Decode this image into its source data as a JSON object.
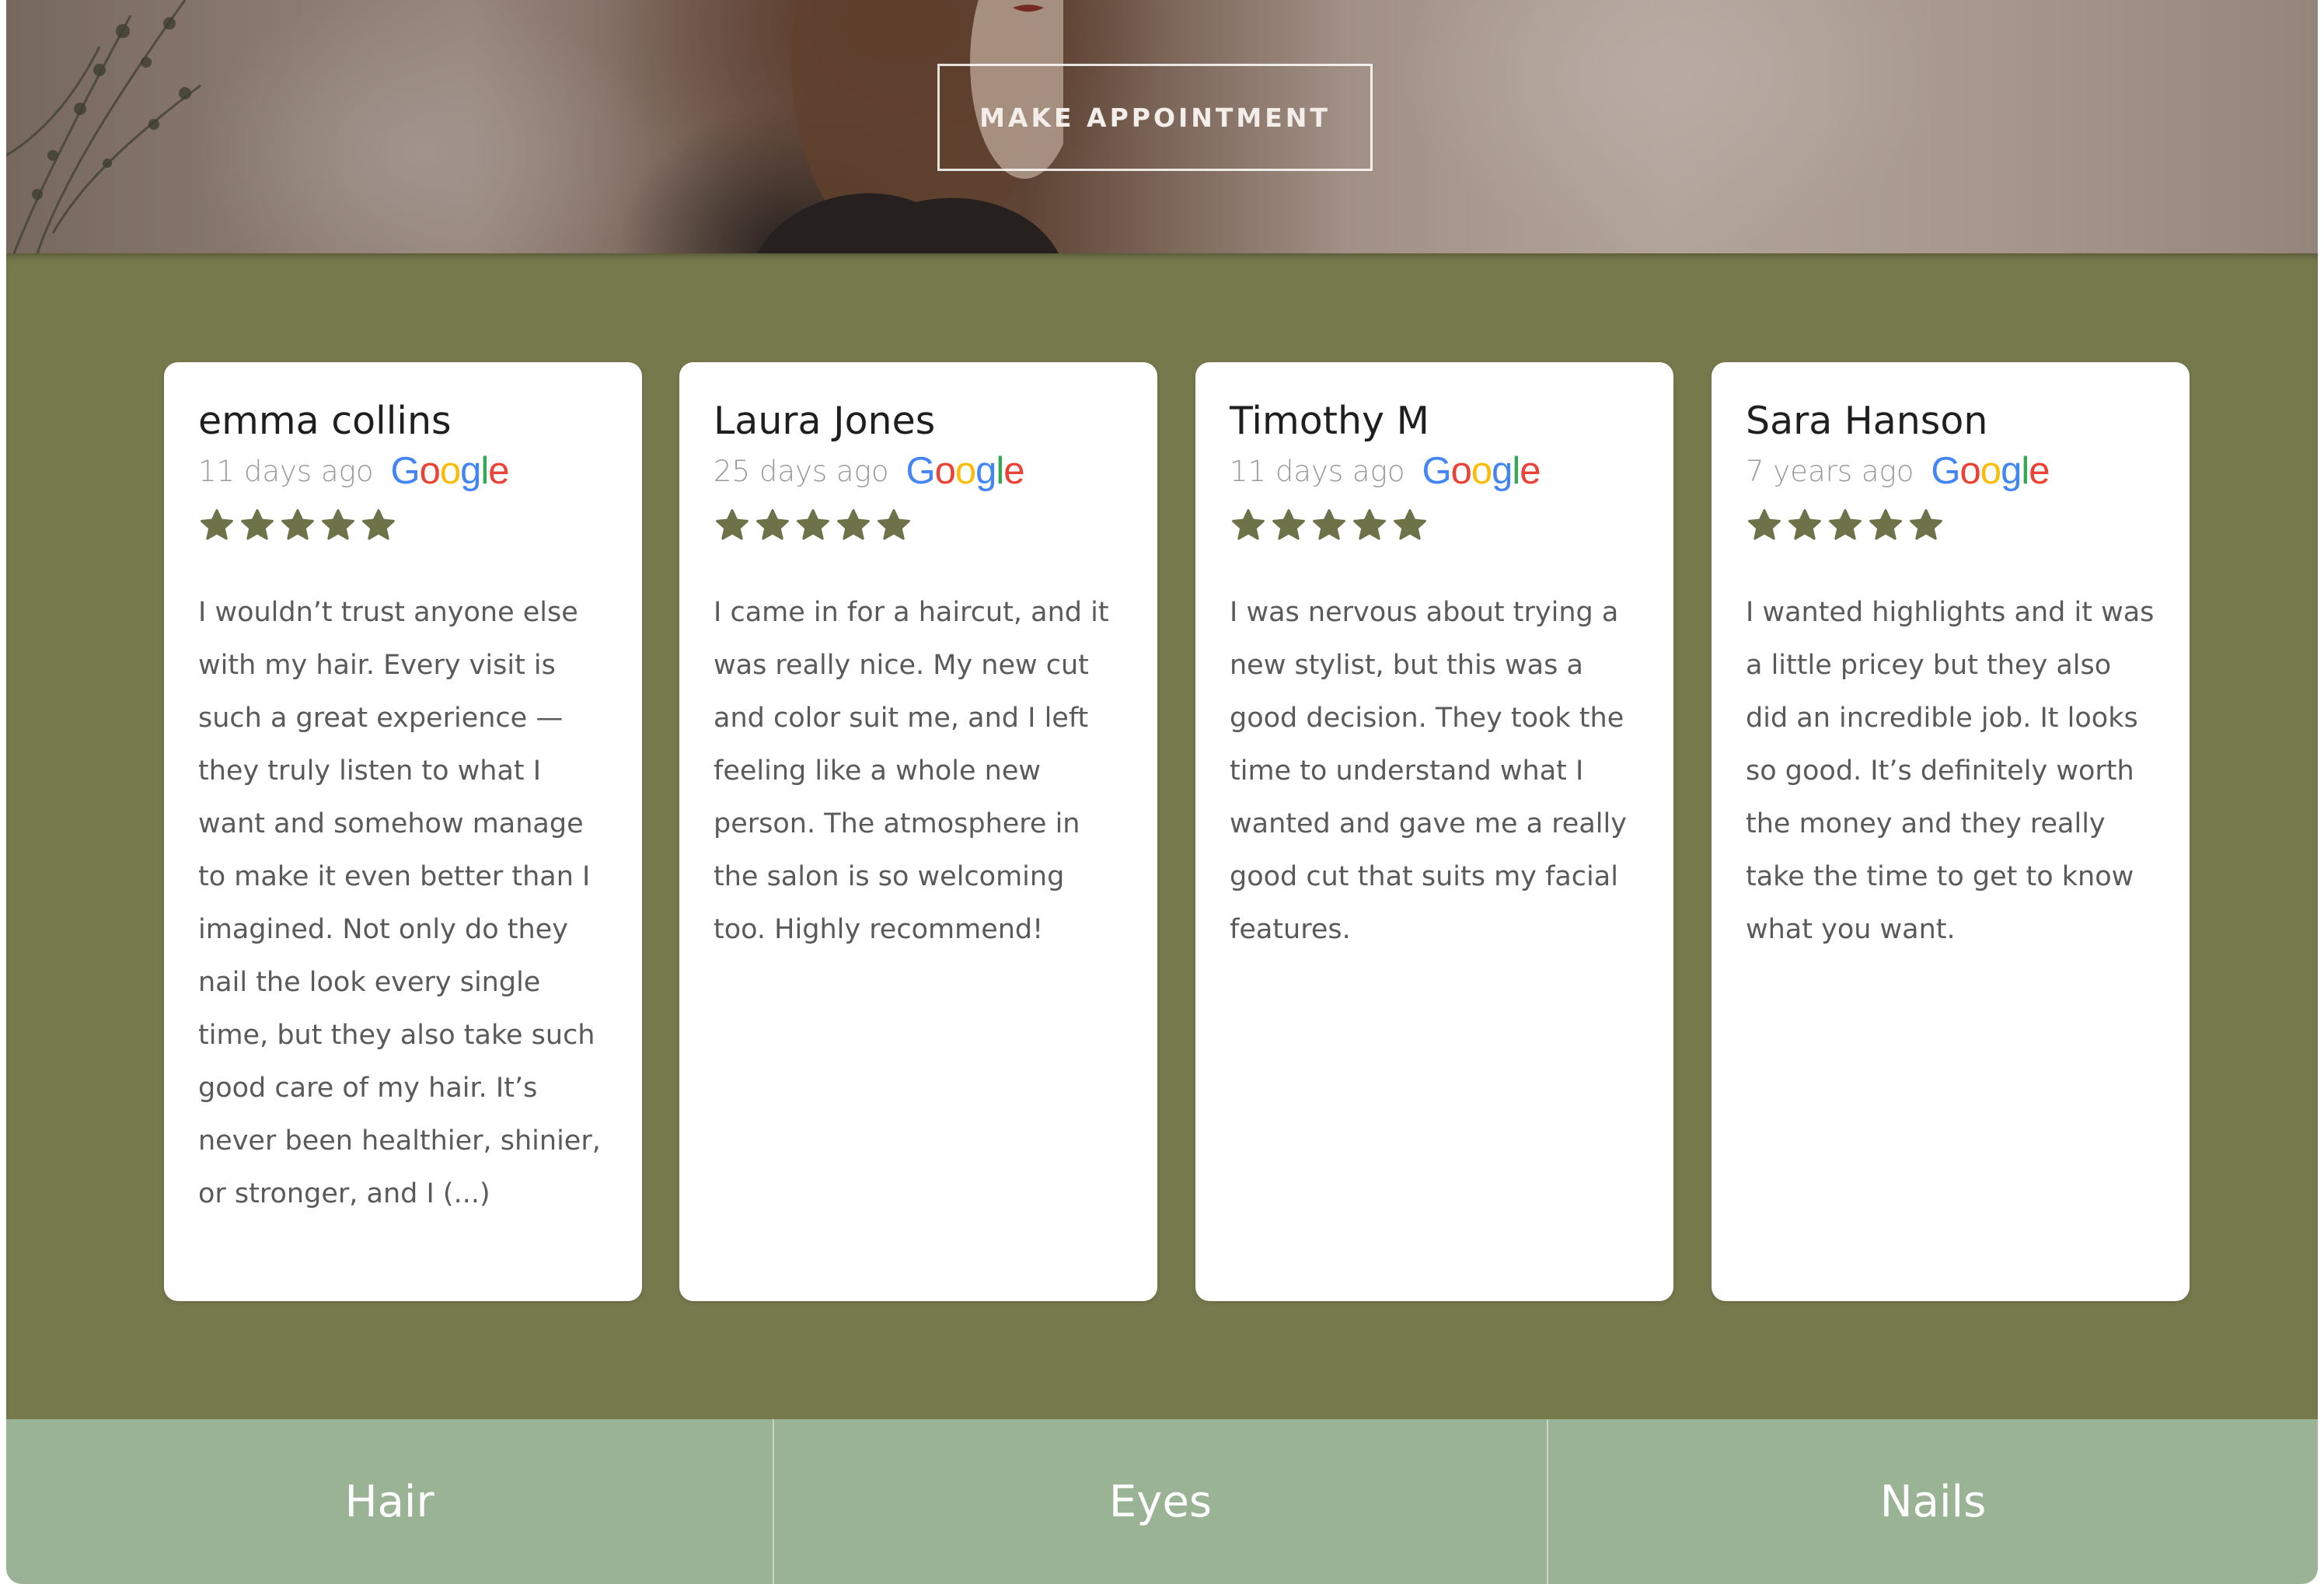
{
  "hero": {
    "cta_label": "MAKE APPOINTMENT"
  },
  "reviews": [
    {
      "name": "emma collins",
      "date": "11 days ago",
      "source": "Google",
      "rating": 5,
      "text": "I wouldn’t trust anyone else with my hair. Every visit is such a great experience — they truly listen to what I want and somehow manage to make it even better than I imagined. Not only do they nail the look every single time, but they also take such good care of my hair. It’s never been healthier, shinier, or stronger, and I (...)"
    },
    {
      "name": "Laura Jones",
      "date": "25 days ago",
      "source": "Google",
      "rating": 5,
      "text": "I came in for a haircut, and it was really nice. My new cut and color suit me, and I left feeling like a whole new person. The atmosphere in the salon is so welcoming too. Highly recommend!"
    },
    {
      "name": "Timothy M",
      "date": "11 days ago",
      "source": "Google",
      "rating": 5,
      "text": "I was nervous about trying a new stylist, but this was a good decision. They took the time to understand what I wanted and gave me a really good cut that suits my facial features."
    },
    {
      "name": "Sara Hanson",
      "date": "7 years ago",
      "source": "Google",
      "rating": 5,
      "text": "I wanted highlights and it was a little pricey but they also did an incredible job. It looks so good. It’s definitely worth the money and they really take the time to get to know what you want."
    }
  ],
  "tabs": [
    "Hair",
    "Eyes",
    "Nails"
  ],
  "colors": {
    "band": "#76794c",
    "star": "#6e7248",
    "tabs": "#9bb395"
  },
  "icons": {
    "star": "star-icon",
    "google": "google-logo"
  }
}
